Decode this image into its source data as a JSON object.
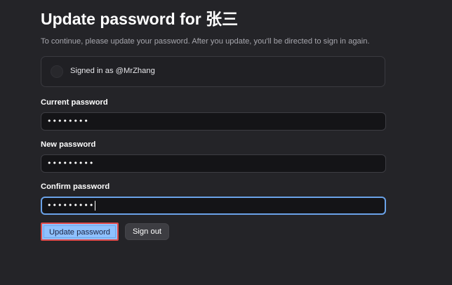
{
  "page": {
    "title": "Update password for 张三",
    "subtitle": "To continue, please update your password. After you update, you'll be directed to sign in again."
  },
  "account": {
    "signed_in_text": "Signed in as @MrZhang"
  },
  "form": {
    "current_password": {
      "label": "Current password",
      "masked_value": "••••••••"
    },
    "new_password": {
      "label": "New password",
      "masked_value": "•••••••••"
    },
    "confirm_password": {
      "label": "Confirm password",
      "masked_value": "•••••••••"
    }
  },
  "actions": {
    "update_label": "Update password",
    "signout_label": "Sign out"
  },
  "colors": {
    "background": "#242428",
    "input_background": "#141417",
    "focus_ring": "#6aa2e8",
    "primary_button": "#8fc1ff",
    "highlight_border": "#e04a4a",
    "secondary_button": "#3d3d42"
  },
  "icons": {
    "avatar": "avatar-placeholder-circle"
  }
}
